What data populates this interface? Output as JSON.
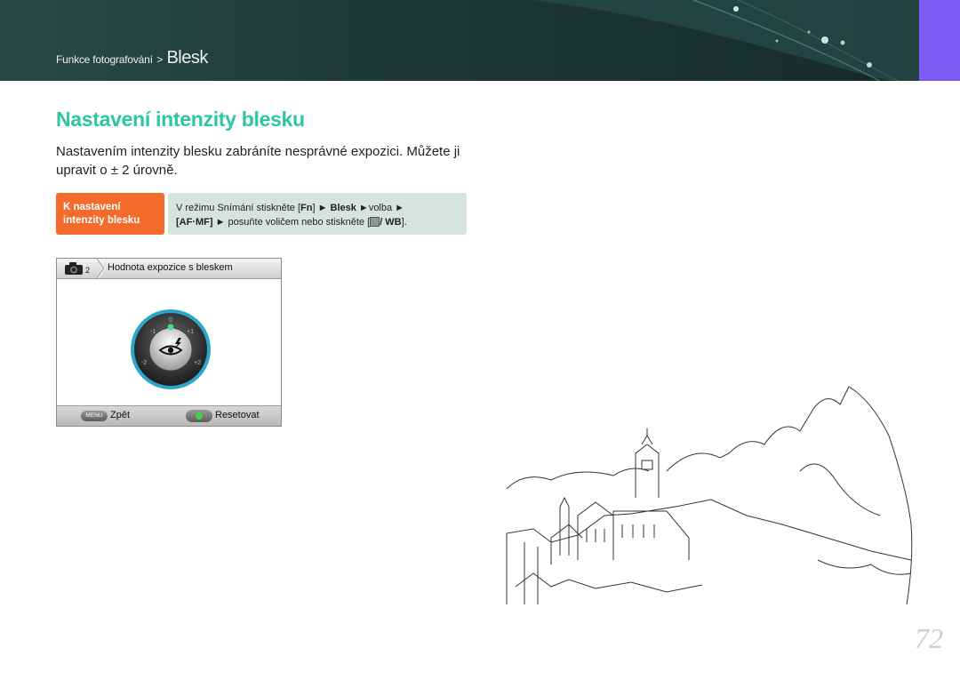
{
  "header": {
    "breadcrumb_parent": "Funkce fotografování",
    "breadcrumb_sep": ">",
    "breadcrumb_current": "Blesk",
    "banner_color": "#1e3935",
    "accent_color": "#7b5cf2"
  },
  "title": "Nastavení intenzity blesku",
  "title_color": "#2cc6a2",
  "intro": "Nastavením intenzity blesku zabráníte nesprávné expozici. Můžete ji upravit o ± 2 úrovně.",
  "instruction": {
    "label_line1": "K nastavení",
    "label_line2": "intenzity blesku",
    "line1_text": "V režimu Snímání stiskněte [",
    "fn_key": "Fn",
    "line1_mid": "] ► ",
    "blesk": "Blesk",
    "line1_end": " ►volba ►",
    "afmf_key": "[AF·MF]",
    "line2_text": " ► posuňte voličem nebo stiskněte [",
    "wb_key": "/ WB",
    "line2_end": "].",
    "label_color": "#f26b2a"
  },
  "screen": {
    "camera_mode_num": "2",
    "header_title": "Hodnota expozice s bleskem",
    "dial_labels": {
      "zero": "0",
      "minus1": "-1",
      "plus1": "+1",
      "minus2": "-2",
      "plus2": "+2"
    },
    "menu_key": "MENU",
    "back_label": "Zpět",
    "reset_label": "Resetovat"
  },
  "page_number": "72"
}
